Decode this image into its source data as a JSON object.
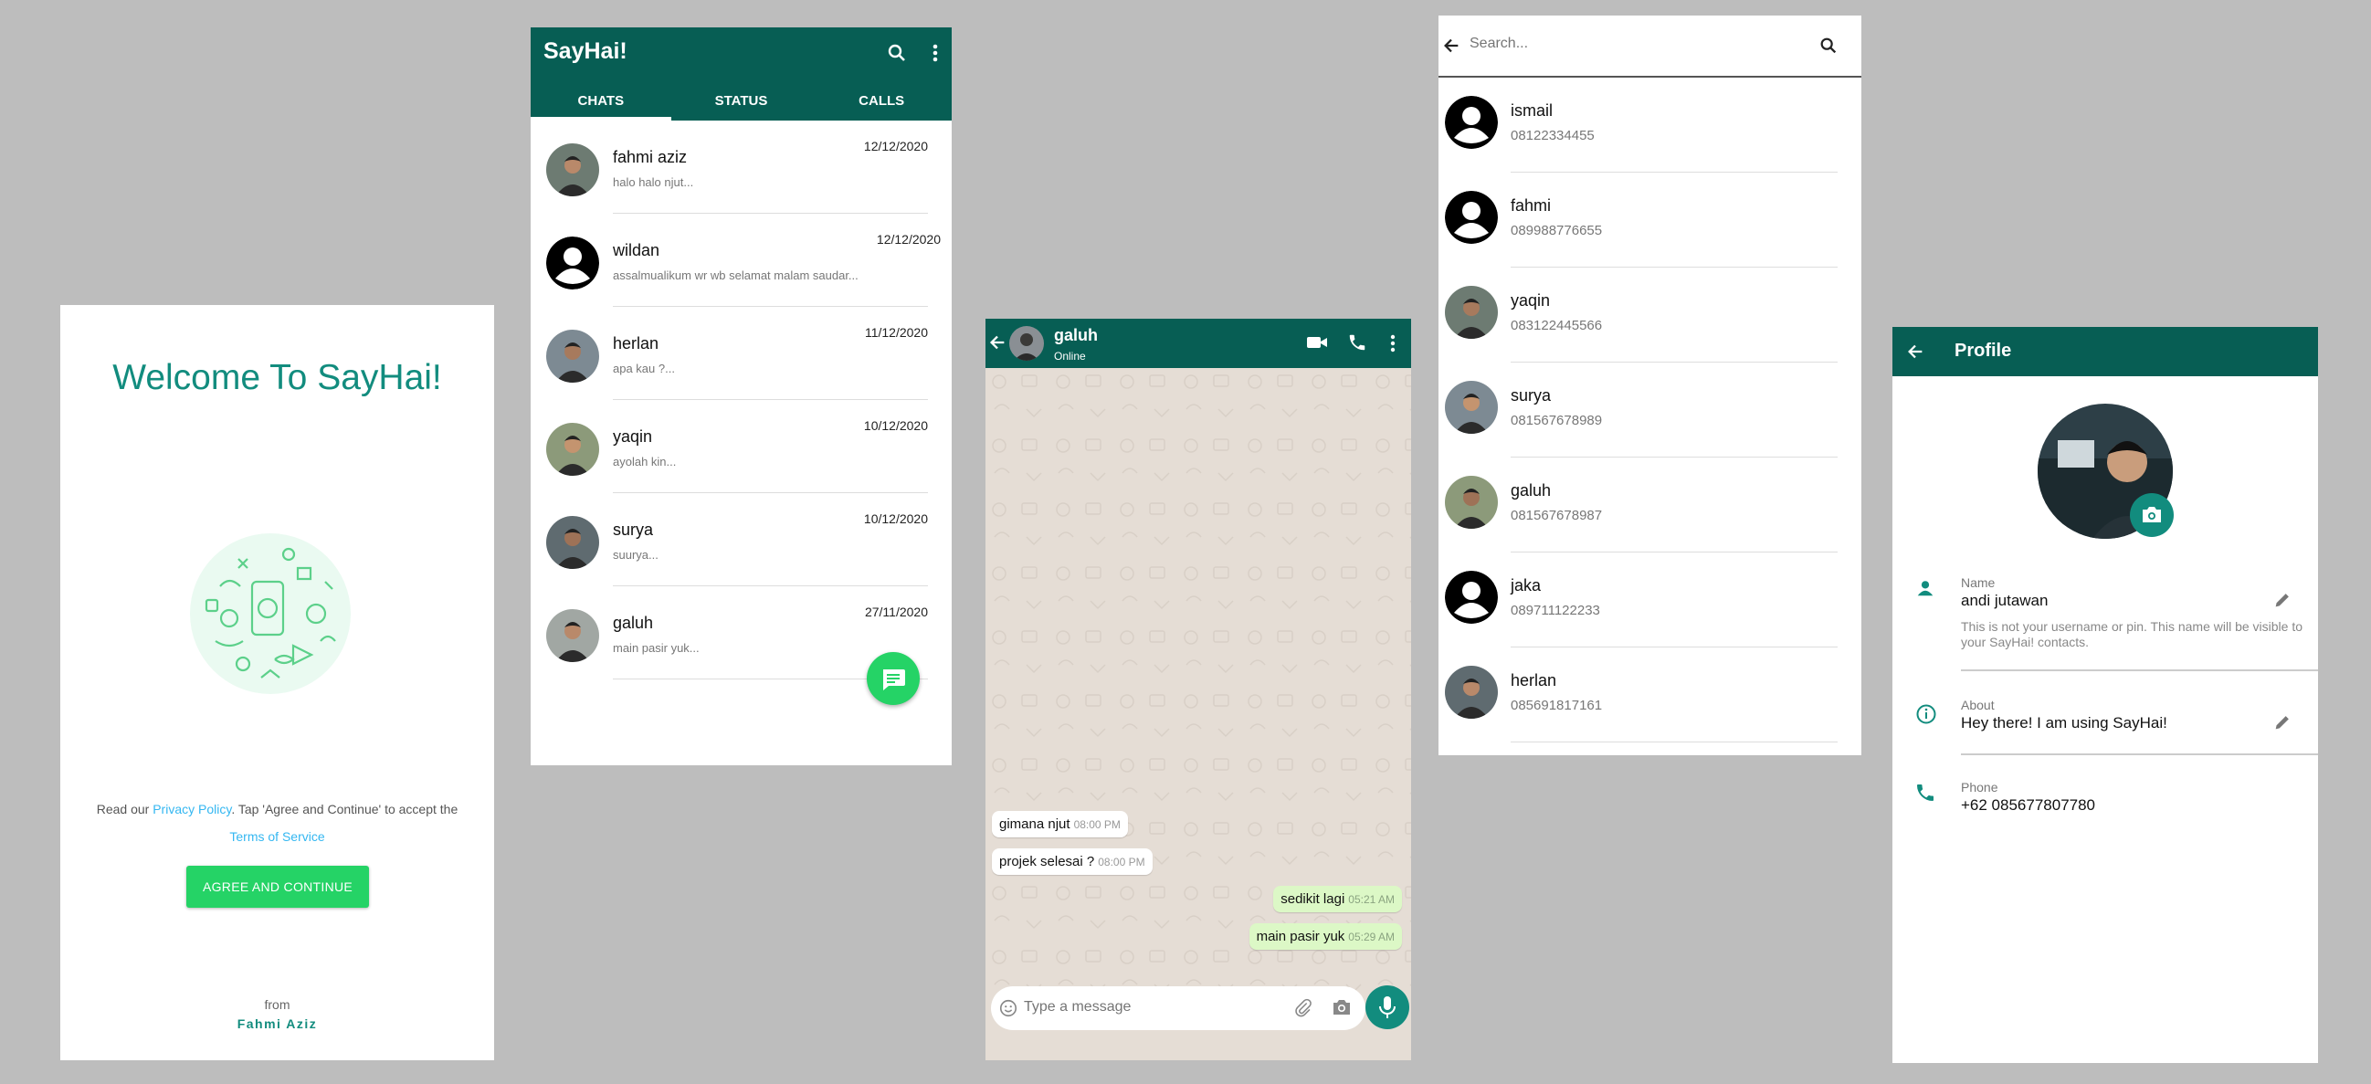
{
  "colors": {
    "teal_dark": "#075e54",
    "teal": "#128c7e",
    "green": "#25d366",
    "link": "#34b7f1",
    "bubble_out": "#dcf8c6",
    "background": "#bdbdbd"
  },
  "welcome": {
    "title": "Welcome To SayHai!",
    "legal_prefix": "Read our ",
    "privacy_link": "Privacy Policy",
    "legal_middle": ". Tap 'Agree and Continue' to accept the",
    "terms_link": "Terms of Service",
    "agree_button": "AGREE AND CONTINUE",
    "from_label": "from",
    "author": "Fahmi Aziz"
  },
  "chats_screen": {
    "app_title": "SayHai!",
    "icons": [
      "search-icon",
      "more-vert-icon",
      "chat-icon"
    ],
    "tabs": [
      {
        "label": "CHATS",
        "active": true
      },
      {
        "label": "STATUS",
        "active": false
      },
      {
        "label": "CALLS",
        "active": false
      }
    ],
    "chats": [
      {
        "name": "fahmi aziz",
        "preview": "halo halo njut...",
        "date": "12/12/2020",
        "avatar": "photo"
      },
      {
        "name": "wildan",
        "preview": "assalmualikum wr wb selamat malam saudar...",
        "date": "12/12/2020",
        "avatar": "default"
      },
      {
        "name": "herlan",
        "preview": "apa kau ?...",
        "date": "11/12/2020",
        "avatar": "photo"
      },
      {
        "name": "yaqin",
        "preview": "ayolah kin...",
        "date": "10/12/2020",
        "avatar": "photo"
      },
      {
        "name": "surya",
        "preview": "suurya...",
        "date": "10/12/2020",
        "avatar": "photo"
      },
      {
        "name": "galuh",
        "preview": "main pasir yuk...",
        "date": "27/11/2020",
        "avatar": "photo"
      }
    ]
  },
  "conversation": {
    "contact_name": "galuh",
    "status": "Online",
    "icons": [
      "back-arrow-icon",
      "video-call-icon",
      "phone-icon",
      "more-vert-icon",
      "emoji-icon",
      "attach-icon",
      "camera-icon",
      "mic-icon"
    ],
    "messages": [
      {
        "text": "gimana njut",
        "time": "08:00 PM",
        "direction": "in"
      },
      {
        "text": "projek selesai ?",
        "time": "08:00 PM",
        "direction": "in"
      },
      {
        "text": "sedikit lagi",
        "time": "05:21 AM",
        "direction": "out"
      },
      {
        "text": "main pasir yuk",
        "time": "05:29 AM",
        "direction": "out"
      }
    ],
    "input_placeholder": "Type a message"
  },
  "contacts_screen": {
    "search_placeholder": "Search...",
    "contacts": [
      {
        "name": "ismail",
        "phone": "08122334455",
        "avatar": "default"
      },
      {
        "name": "fahmi",
        "phone": "089988776655",
        "avatar": "default"
      },
      {
        "name": "yaqin",
        "phone": "083122445566",
        "avatar": "photo"
      },
      {
        "name": "surya",
        "phone": "081567678989",
        "avatar": "photo"
      },
      {
        "name": "galuh",
        "phone": "081567678987",
        "avatar": "photo"
      },
      {
        "name": "jaka",
        "phone": "089711122233",
        "avatar": "default"
      },
      {
        "name": "herlan",
        "phone": "085691817161",
        "avatar": "photo"
      }
    ]
  },
  "profile_screen": {
    "title": "Profile",
    "name_label": "Name",
    "name_value": "andi jutawan",
    "name_help": "This is not your username or pin. This name will be visible to your SayHai! contacts.",
    "about_label": "About",
    "about_value": "Hey there! I am using SayHai!",
    "phone_label": "Phone",
    "phone_value": "+62 085677807780"
  }
}
